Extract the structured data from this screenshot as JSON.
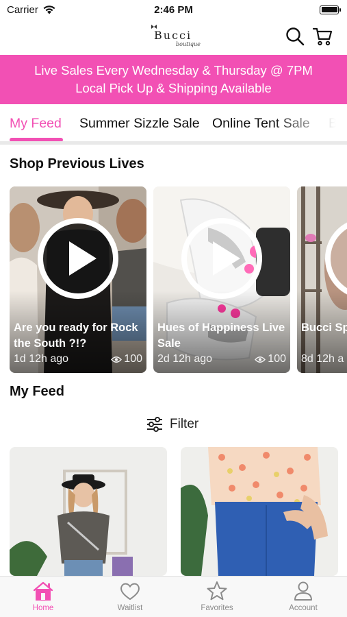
{
  "status_bar": {
    "carrier": "Carrier",
    "time": "2:46 PM"
  },
  "header": {
    "logo_text": "Bucci",
    "logo_sub": "boutique"
  },
  "banner": {
    "line1": "Live Sales Every Wednesday & Thursday @ 7PM",
    "line2": "Local Pick Up & Shipping Available",
    "color": "#f250b4"
  },
  "tabs": [
    {
      "label": "My Feed",
      "active": true
    },
    {
      "label": "Summer Sizzle Sale",
      "active": false
    },
    {
      "label": "Online Tent Sale",
      "active": false
    },
    {
      "label": "B",
      "active": false
    }
  ],
  "previous_lives": {
    "title": "Shop Previous Lives",
    "cards": [
      {
        "title": "Are you ready for Rock the South ?!?",
        "time": "1d 12h ago",
        "views": "100"
      },
      {
        "title": "Hues of Happiness Live Sale",
        "time": "2d 12h ago",
        "views": "100"
      },
      {
        "title": "Bucci Sp",
        "time": "8d 12h a",
        "views": ""
      }
    ]
  },
  "feed": {
    "title": "My Feed",
    "filter_label": "Filter"
  },
  "bottom_nav": [
    {
      "label": "Home",
      "icon": "home-icon",
      "active": true
    },
    {
      "label": "Waitlist",
      "icon": "heart-icon",
      "active": false
    },
    {
      "label": "Favorites",
      "icon": "star-icon",
      "active": false
    },
    {
      "label": "Account",
      "icon": "user-icon",
      "active": false
    }
  ]
}
